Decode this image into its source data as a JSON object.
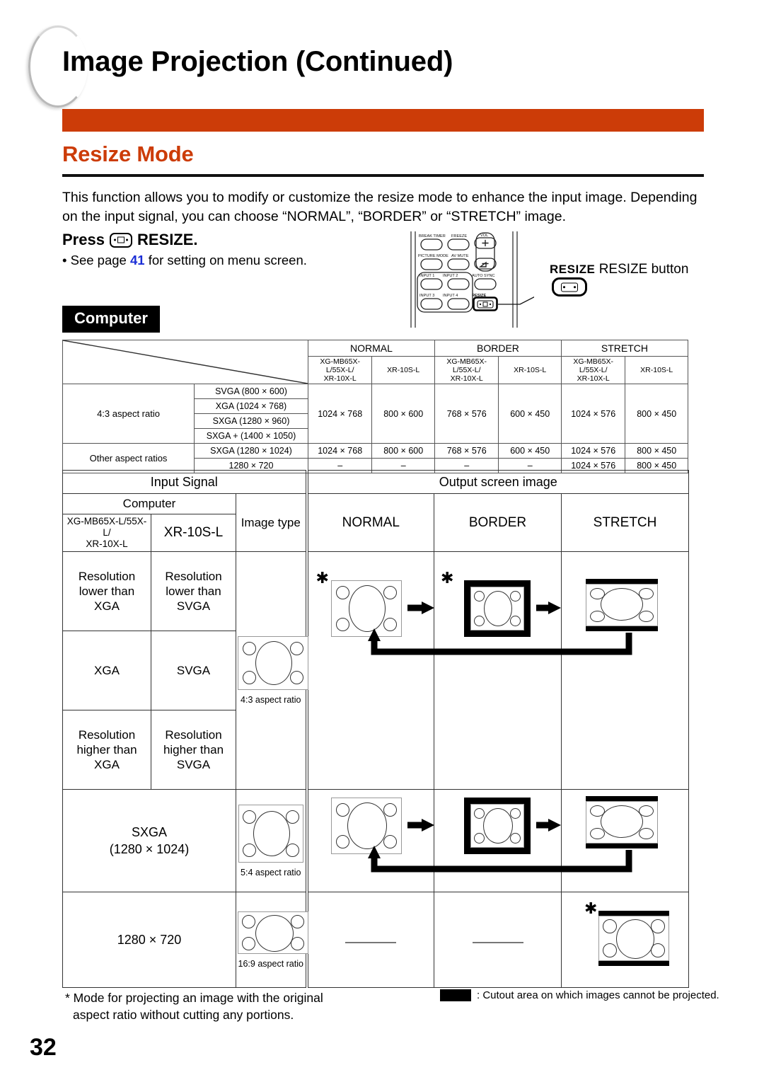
{
  "header": {
    "title": "Image Projection (Continued)",
    "accent_color": "#cc3c08"
  },
  "section": {
    "title": "Resize Mode",
    "intro": "This function allows you to modify or customize the resize mode to enhance the input image. Depending on the input signal, you can choose “NORMAL”, “BORDER” or “STRETCH” image.",
    "press_prefix": "Press",
    "press_suffix": "RESIZE.",
    "see_page_pre": "• See page",
    "see_page_num": "41",
    "see_page_post": "for setting on menu screen."
  },
  "remote": {
    "labels": [
      "BREAK TIMER",
      "FREEZE",
      "VOL",
      "PICTURE MODE",
      "AV MUTE",
      "INPUT 1",
      "INPUT 2",
      "AUTO SYNC",
      "INPUT 3",
      "INPUT 4",
      "RESIZE"
    ],
    "callout_bold": "RESIZE",
    "callout_text": "RESIZE button"
  },
  "tag": {
    "computer": "Computer"
  },
  "table1": {
    "modes": [
      "NORMAL",
      "BORDER",
      "STRETCH"
    ],
    "model_a": "XG-MB65X-L/55X-L/\nXR-10X-L",
    "model_a_line1": "XG-MB65X-L/55X-L/",
    "model_a_line2": "XR-10X-L",
    "model_b": "XR-10S-L",
    "groups": [
      {
        "label": "4:3 aspect ratio",
        "resolutions": [
          "SVGA (800 × 600)",
          "XGA (1024 × 768)",
          "SXGA (1280 × 960)",
          "SXGA + (1400 × 1050)"
        ],
        "values": [
          "1024 × 768",
          "800 × 600",
          "768 × 576",
          "600 × 450",
          "1024 × 576",
          "800 × 450"
        ]
      },
      {
        "label": "Other aspect ratios",
        "rows": [
          {
            "resolution": "SXGA (1280 × 1024)",
            "values": [
              "1024 × 768",
              "800 × 600",
              "768 × 576",
              "600 × 450",
              "1024 × 576",
              "800 × 450"
            ]
          },
          {
            "resolution": "1280 × 720",
            "values": [
              "–",
              "–",
              "–",
              "–",
              "1024 × 576",
              "800 × 450"
            ]
          }
        ]
      }
    ]
  },
  "table2": {
    "head_input_signal": "Input Signal",
    "head_output": "Output screen image",
    "head_computer": "Computer",
    "head_model_a_l1": "XG-MB65X-L/55X-L/",
    "head_model_a_l2": "XR-10X-L",
    "head_model_b": "XR-10S-L",
    "head_image_type": "Image type",
    "head_modes": [
      "NORMAL",
      "BORDER",
      "STRETCH"
    ],
    "rows": [
      {
        "model_a": "Resolution\nlower than\nXGA",
        "model_a_lines": [
          "Resolution",
          "lower than",
          "XGA"
        ],
        "model_b_lines": [
          "Resolution",
          "lower than",
          "SVGA"
        ],
        "image_type": null,
        "aspect_caption": null
      },
      {
        "model_a_lines": [
          "XGA"
        ],
        "model_b_lines": [
          "SVGA"
        ],
        "aspect_caption": "4:3 aspect ratio",
        "normal_star": "✱",
        "border_star": "✱"
      },
      {
        "model_a_lines": [
          "Resolution",
          "higher than",
          "XGA"
        ],
        "model_b_lines": [
          "Resolution",
          "higher than",
          "SVGA"
        ],
        "aspect_caption": null
      },
      {
        "signal_lines": [
          "SXGA",
          "(1280 × 1024)"
        ],
        "aspect_caption": "5:4 aspect ratio"
      },
      {
        "signal_lines": [
          "1280 × 720"
        ],
        "aspect_caption": "16:9 aspect ratio",
        "stretch_star": "✱",
        "normal_dash": true,
        "border_dash": true
      }
    ]
  },
  "footnotes": {
    "left_l1": "* Mode for projecting an image with the original",
    "left_l2": "aspect ratio without cutting any portions.",
    "right": ": Cutout area on which images cannot be projected."
  },
  "page_number": "32"
}
